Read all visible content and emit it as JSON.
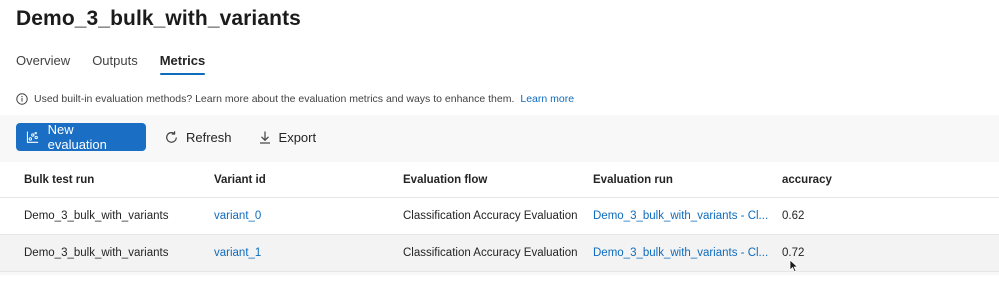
{
  "page": {
    "title": "Demo_3_bulk_with_variants"
  },
  "tabs": [
    {
      "label": "Overview",
      "active": false
    },
    {
      "label": "Outputs",
      "active": false
    },
    {
      "label": "Metrics",
      "active": true
    }
  ],
  "info": {
    "icon": "info-icon",
    "text": "Used built-in evaluation methods? Learn more about the evaluation metrics and ways to enhance them.",
    "link_label": "Learn more"
  },
  "toolbar": {
    "new_evaluation_label": "New evaluation",
    "new_evaluation_icon": "evaluation-chart-icon",
    "refresh_label": "Refresh",
    "refresh_icon": "refresh-icon",
    "export_label": "Export",
    "export_icon": "download-icon"
  },
  "table": {
    "columns": [
      "Bulk test run",
      "Variant id",
      "Evaluation flow",
      "Evaluation run",
      "accuracy"
    ],
    "rows": [
      {
        "bulk_test_run": "Demo_3_bulk_with_variants",
        "variant_id": "variant_0",
        "evaluation_flow": "Classification Accuracy Evaluation",
        "evaluation_run": "Demo_3_bulk_with_variants - Cl...",
        "accuracy": "0.62"
      },
      {
        "bulk_test_run": "Demo_3_bulk_with_variants",
        "variant_id": "variant_1",
        "evaluation_flow": "Classification Accuracy Evaluation",
        "evaluation_run": "Demo_3_bulk_with_variants - Cl...",
        "accuracy": "0.72"
      }
    ]
  },
  "colors": {
    "accent": "#0f6cbd",
    "primary_button": "#1a6fc4",
    "toolbar_bg": "#f8f8f8",
    "selected_row_bg": "#f3f3f3"
  }
}
